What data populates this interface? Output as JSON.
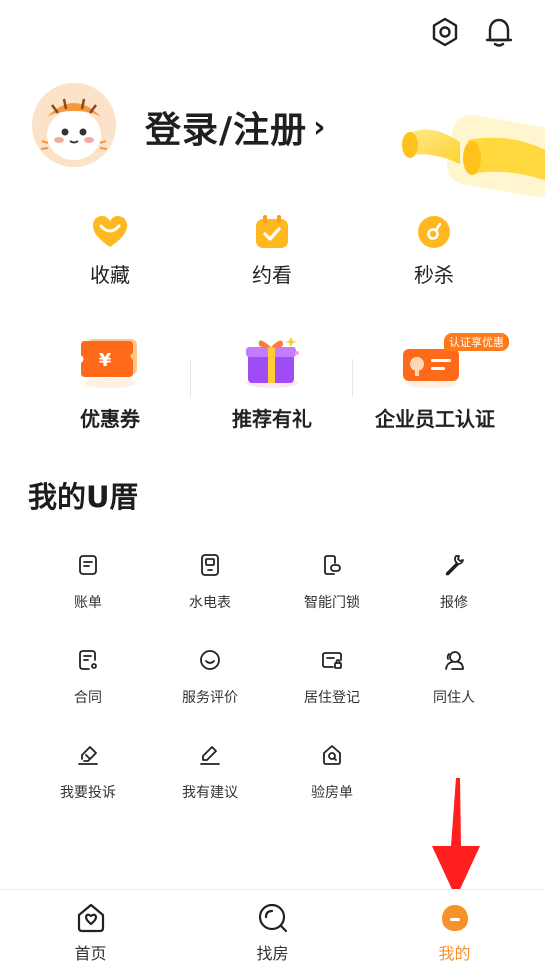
{
  "header": {
    "settings_icon": "gear-icon",
    "bell_icon": "bell-icon"
  },
  "profile": {
    "login_label": "登录/注册",
    "chevron": "›"
  },
  "quick_actions": [
    {
      "label": "收藏",
      "icon": "heart-icon"
    },
    {
      "label": "约看",
      "icon": "calendar-check-icon"
    },
    {
      "label": "秒杀",
      "icon": "flash-sale-icon"
    }
  ],
  "promos": [
    {
      "label": "优惠券",
      "icon": "coupon-icon",
      "badge": "¥"
    },
    {
      "label": "推荐有礼",
      "icon": "gift-icon"
    },
    {
      "label": "企业员工认证",
      "icon": "employee-card-icon",
      "badge": "认证享优惠"
    }
  ],
  "section": {
    "title": "我的U厝"
  },
  "services": [
    {
      "label": "账单",
      "icon": "bill-icon"
    },
    {
      "label": "水电表",
      "icon": "meter-icon"
    },
    {
      "label": "智能门锁",
      "icon": "smart-lock-icon"
    },
    {
      "label": "报修",
      "icon": "wrench-icon"
    },
    {
      "label": "合同",
      "icon": "contract-icon"
    },
    {
      "label": "服务评价",
      "icon": "smile-icon"
    },
    {
      "label": "居住登记",
      "icon": "residence-card-icon"
    },
    {
      "label": "同住人",
      "icon": "co-resident-icon"
    },
    {
      "label": "我要投诉",
      "icon": "complaint-icon"
    },
    {
      "label": "我有建议",
      "icon": "suggestion-pencil-icon"
    },
    {
      "label": "验房单",
      "icon": "inspection-house-icon"
    }
  ],
  "tabs": [
    {
      "label": "首页",
      "icon": "home-icon"
    },
    {
      "label": "找房",
      "icon": "search-house-icon"
    },
    {
      "label": "我的",
      "icon": "profile-face-icon",
      "active": true
    }
  ],
  "colors": {
    "accent": "#f5922a",
    "annotation_arrow": "#ff1f1f"
  }
}
